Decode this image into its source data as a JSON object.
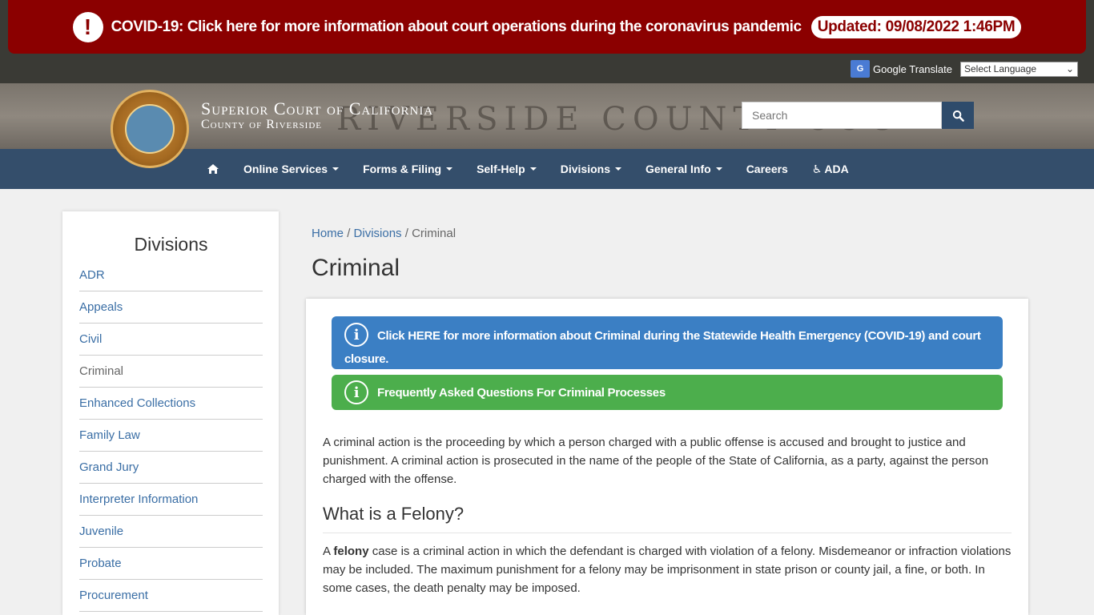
{
  "alert": {
    "message": "COVID-19: Click here for more information about court operations during the coronavirus pandemic",
    "updated": "Updated: 09/08/2022 1:46PM"
  },
  "translate": {
    "label": "Google Translate",
    "select_value": "Select Language"
  },
  "header": {
    "title": "Superior Court of California",
    "subtitle": "County of Riverside",
    "bg_text": "RIVERSIDE COUNTY COU",
    "search_placeholder": "Search"
  },
  "nav": {
    "items": [
      {
        "label": "Online Services",
        "dropdown": true
      },
      {
        "label": "Forms & Filing",
        "dropdown": true
      },
      {
        "label": "Self-Help",
        "dropdown": true
      },
      {
        "label": "Divisions",
        "dropdown": true
      },
      {
        "label": "General Info",
        "dropdown": true
      },
      {
        "label": "Careers",
        "dropdown": false
      },
      {
        "label": "ADA",
        "dropdown": false
      }
    ]
  },
  "sidebar": {
    "title": "Divisions",
    "items": [
      "ADR",
      "Appeals",
      "Civil",
      "Criminal",
      "Enhanced Collections",
      "Family Law",
      "Grand Jury",
      "Interpreter Information",
      "Juvenile",
      "Probate",
      "Procurement"
    ],
    "active": "Criminal"
  },
  "breadcrumb": {
    "home": "Home",
    "divisions": "Divisions",
    "current": "Criminal"
  },
  "page": {
    "title": "Criminal",
    "banner_blue": "Click HERE for more information about Criminal during the Statewide Health Emergency (COVID-19) and court closure.",
    "banner_green": "Frequently Asked Questions For Criminal Processes",
    "para1": "A criminal action is the proceeding by which a person charged with a public offense is accused and brought to justice and punishment.   A criminal action is prosecuted in the name of the people of the State of California, as a party, against the person charged with the offense.",
    "felony_heading": "What is a Felony?",
    "para2_pre": "A ",
    "para2_bold": "felony",
    "para2_post": " case is a criminal action in which the defendant is charged with violation of a felony. Misdemeanor or infraction violations may be included. The maximum punishment for a felony may be imprisonment in state prison or county jail, a fine, or both. In some cases, the death penalty may be imposed."
  },
  "colors": {
    "alert_red": "#8b0000",
    "nav_blue": "#344e6b",
    "banner_blue": "#3b7fc4",
    "banner_green": "#4cae4c",
    "link": "#3a6ea5"
  }
}
